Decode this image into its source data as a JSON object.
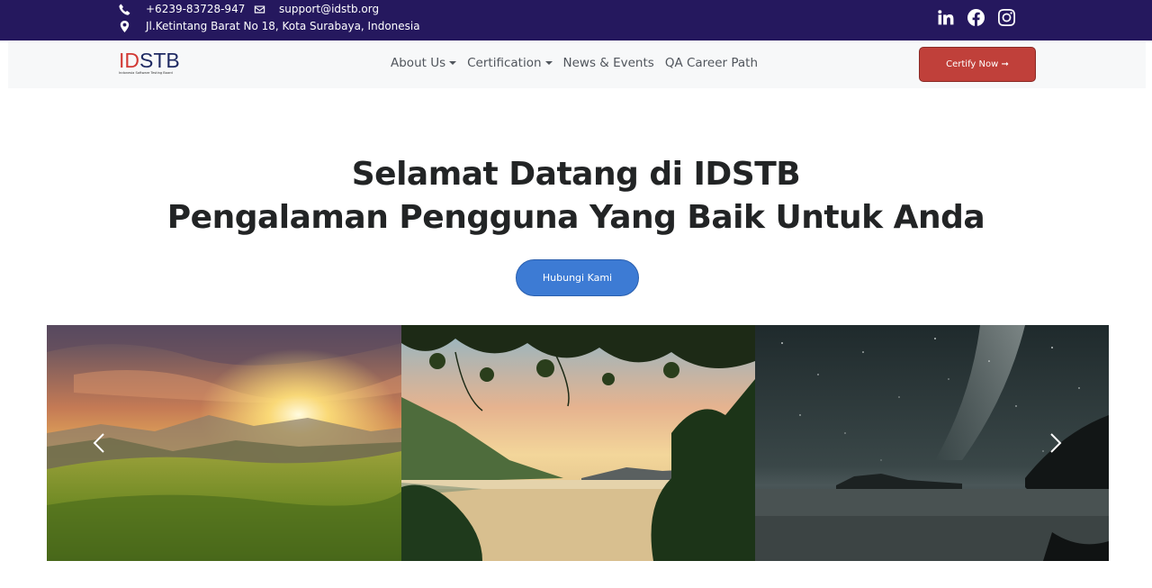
{
  "topbar": {
    "phone": "+6239-83728-947",
    "email": "support@idstb.org",
    "address": "Jl.Ketintang Barat No 18, Kota Surabaya, Indonesia",
    "social": [
      "linkedin-icon",
      "facebook-icon",
      "instagram-icon"
    ]
  },
  "brand": {
    "logo_part1": "ID",
    "logo_part2": "STB",
    "tagline": "Indonesia Software Testing Board"
  },
  "nav": {
    "items": [
      {
        "label": "About Us",
        "dropdown": true
      },
      {
        "label": "Certification",
        "dropdown": true
      },
      {
        "label": "News & Events",
        "dropdown": false
      },
      {
        "label": "QA Career Path",
        "dropdown": false
      }
    ],
    "cta_label": "Certify Now ➞"
  },
  "hero": {
    "line1": "Selamat Datang di IDSTB",
    "line2": "Pengalaman Pengguna Yang Baik Untuk Anda",
    "button_label": "Hubungi Kami"
  },
  "carousel": {
    "slides": [
      "sunrise-mountain-meadow",
      "lake-through-leaves",
      "night-sky-lake"
    ]
  },
  "colors": {
    "topbar": "#25185e",
    "cta": "#c0403a",
    "contact_button": "#3d7bd4",
    "navbar": "#f7f8f9"
  }
}
